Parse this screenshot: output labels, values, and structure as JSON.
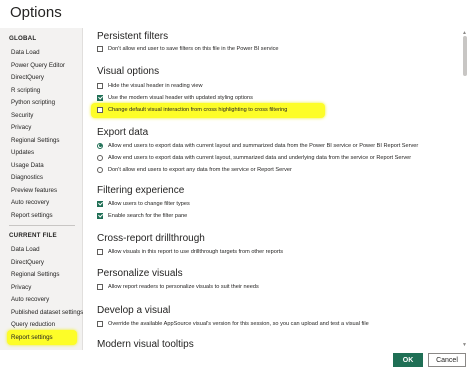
{
  "window": {
    "title": "Options"
  },
  "sidebar": {
    "global_heading": "GLOBAL",
    "global_items": [
      {
        "label": "Data Load"
      },
      {
        "label": "Power Query Editor"
      },
      {
        "label": "DirectQuery"
      },
      {
        "label": "R scripting"
      },
      {
        "label": "Python scripting"
      },
      {
        "label": "Security"
      },
      {
        "label": "Privacy"
      },
      {
        "label": "Regional Settings"
      },
      {
        "label": "Updates"
      },
      {
        "label": "Usage Data"
      },
      {
        "label": "Diagnostics"
      },
      {
        "label": "Preview features"
      },
      {
        "label": "Auto recovery"
      },
      {
        "label": "Report settings"
      }
    ],
    "current_heading": "CURRENT FILE",
    "current_items": [
      {
        "label": "Data Load"
      },
      {
        "label": "DirectQuery"
      },
      {
        "label": "Regional Settings"
      },
      {
        "label": "Privacy"
      },
      {
        "label": "Auto recovery"
      },
      {
        "label": "Published dataset settings"
      },
      {
        "label": "Query reduction"
      },
      {
        "label": "Report settings"
      }
    ],
    "selected_item": "Report settings",
    "highlight_color": "#fdfd28"
  },
  "content": {
    "sections": [
      {
        "title": "Persistent filters",
        "options": [
          {
            "type": "checkbox",
            "checked": false,
            "label": "Don't allow end user to save filters on this file in the Power BI service"
          }
        ]
      },
      {
        "title": "Visual options",
        "options": [
          {
            "type": "checkbox",
            "checked": false,
            "label": "Hide the visual header in reading view"
          },
          {
            "type": "checkbox",
            "checked": true,
            "label": "Use the modern visual header with updated styling options"
          },
          {
            "type": "checkbox",
            "checked": false,
            "label": "Change default visual interaction from cross highlighting to cross filtering",
            "highlighted": true
          }
        ]
      },
      {
        "title": "Export data",
        "options": [
          {
            "type": "radio",
            "checked": true,
            "label": "Allow end users to export data with current layout and summarized data from the Power BI service or Power BI Report Server"
          },
          {
            "type": "radio",
            "checked": false,
            "label": "Allow end users to export data with current layout, summarized data and underlying data from the service or Report Server"
          },
          {
            "type": "radio",
            "checked": false,
            "label": "Don't allow end users to export any data from the service or Report Server"
          }
        ]
      },
      {
        "title": "Filtering experience",
        "options": [
          {
            "type": "checkbox",
            "checked": true,
            "label": "Allow users to change filter types"
          },
          {
            "type": "checkbox",
            "checked": true,
            "label": "Enable search for the filter pane"
          }
        ]
      },
      {
        "title": "Cross-report drillthrough",
        "options": [
          {
            "type": "checkbox",
            "checked": false,
            "label": "Allow visuals in this report to use drillthrough targets from other reports"
          }
        ]
      },
      {
        "title": "Personalize visuals",
        "options": [
          {
            "type": "checkbox",
            "checked": false,
            "label": "Allow report readers to personalize visuals to suit their needs"
          }
        ]
      },
      {
        "title": "Develop a visual",
        "options": [
          {
            "type": "checkbox",
            "checked": false,
            "label": "Override the available AppSource visual's version for this session, so you can upload and test a visual file"
          }
        ]
      },
      {
        "title": "Modern visual tooltips",
        "options": []
      }
    ]
  },
  "buttons": {
    "ok": "OK",
    "cancel": "Cancel"
  },
  "colors": {
    "accent": "#1f6f55",
    "highlight": "#fdfd28"
  }
}
